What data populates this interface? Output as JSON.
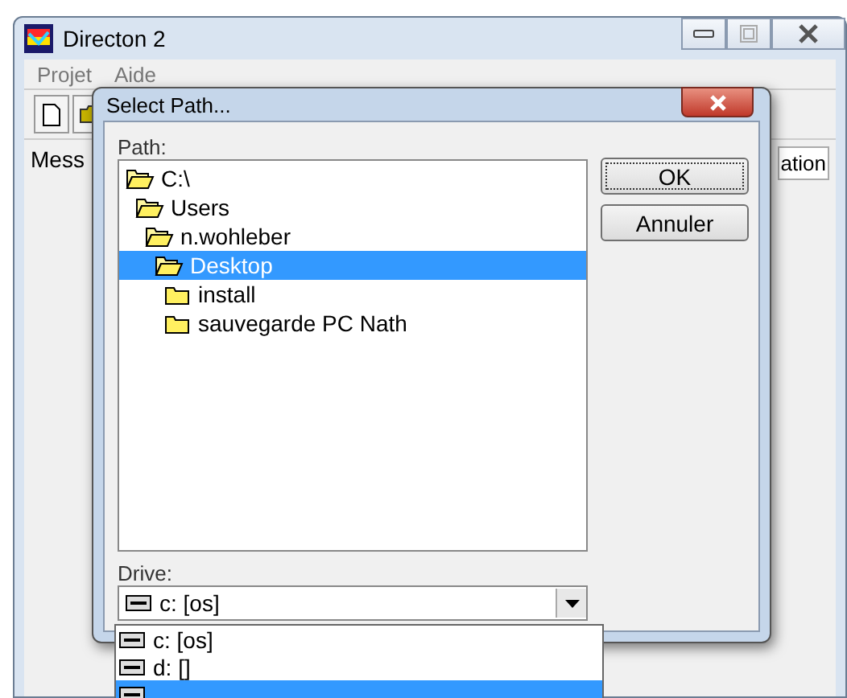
{
  "window": {
    "title": "Directon 2"
  },
  "menu": [
    {
      "label": "Projet"
    },
    {
      "label": "Aide"
    }
  ],
  "panel_tabs": {
    "left": "Mess",
    "right": "ation"
  },
  "dialog": {
    "title": "Select Path...",
    "path_label": "Path:",
    "tree": [
      {
        "label": "C:\\",
        "open": true,
        "selected": false,
        "children": [
          {
            "label": "Users",
            "open": true,
            "selected": false,
            "children": [
              {
                "label": "n.wohleber",
                "open": true,
                "selected": false,
                "children": [
                  {
                    "label": "Desktop",
                    "open": true,
                    "selected": true,
                    "children": [
                      {
                        "label": "install",
                        "open": false,
                        "selected": false
                      },
                      {
                        "label": "sauvegarde PC Nath",
                        "open": false,
                        "selected": false
                      }
                    ]
                  }
                ]
              }
            ]
          }
        ]
      }
    ],
    "buttons": [
      {
        "label": "OK",
        "default": true
      },
      {
        "label": "Annuler",
        "default": false
      }
    ],
    "drive_label": "Drive:",
    "drive_value": "c: [os]",
    "drive_options": [
      {
        "label": "c: [os]",
        "selected": false
      },
      {
        "label": "d: []",
        "selected": false
      },
      {
        "selected": true
      }
    ]
  }
}
